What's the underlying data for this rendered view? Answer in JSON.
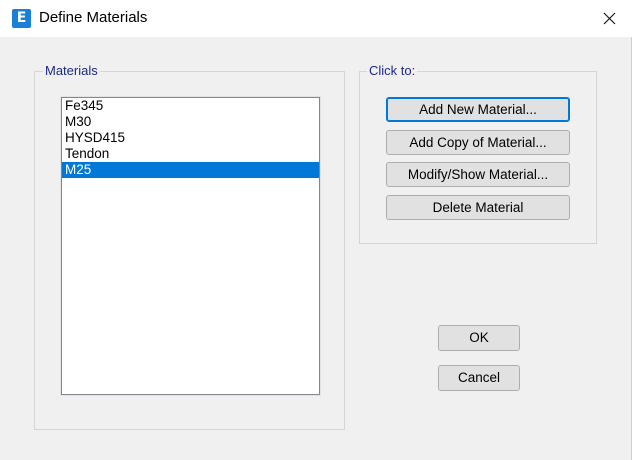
{
  "window": {
    "title": "Define Materials",
    "app_icon_letter": "E"
  },
  "materials_group": {
    "label": "Materials",
    "items": [
      {
        "label": "Fe345",
        "selected": false
      },
      {
        "label": "M30",
        "selected": false
      },
      {
        "label": "HYSD415",
        "selected": false
      },
      {
        "label": "Tendon",
        "selected": false
      },
      {
        "label": "M25",
        "selected": true
      }
    ]
  },
  "click_to_group": {
    "label": "Click to:",
    "add_new_label": "Add New Material...",
    "add_copy_label": "Add Copy of Material...",
    "modify_show_label": "Modify/Show Material...",
    "delete_label": "Delete Material"
  },
  "dialog_buttons": {
    "ok_label": "OK",
    "cancel_label": "Cancel"
  },
  "colors": {
    "selection": "#0078d7",
    "group_label": "#1b2a8a",
    "app_icon": "#1a7fd6"
  },
  "icons": {
    "app": "etabs-app-icon",
    "close": "close-icon"
  }
}
